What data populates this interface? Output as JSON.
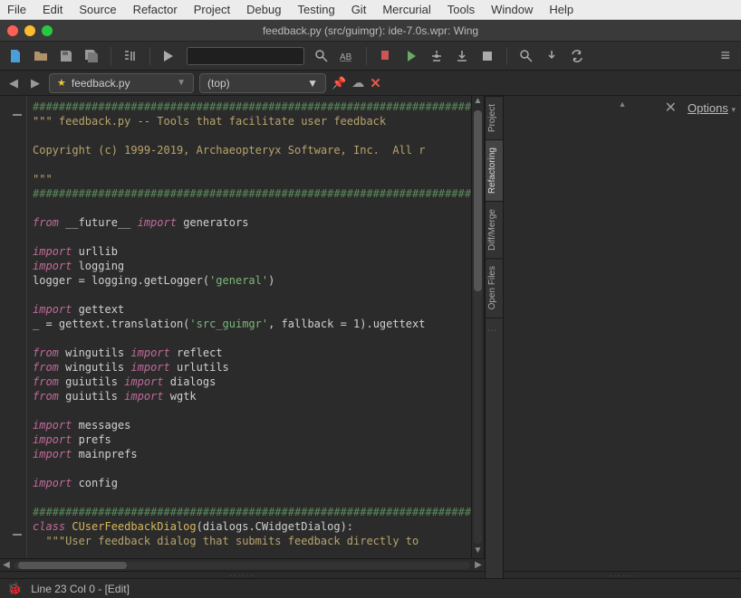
{
  "menubar": [
    "File",
    "Edit",
    "Source",
    "Refactor",
    "Project",
    "Debug",
    "Testing",
    "Git",
    "Mercurial",
    "Tools",
    "Window",
    "Help"
  ],
  "window_title": "feedback.py (src/guimgr): ide-7.0s.wpr: Wing",
  "tab": {
    "filename": "feedback.py"
  },
  "scope": {
    "label": "(top)"
  },
  "side": {
    "options_label": "Options",
    "tabs": [
      "Project",
      "Refactoring",
      "Diff/Merge",
      "Open Files"
    ]
  },
  "status": {
    "text": "Line 23 Col 0 - [Edit]"
  },
  "code": {
    "l1": "########################################################################",
    "l2": "\"\"\" feedback.py -- Tools that facilitate user feedback",
    "l3": "",
    "l4": "Copyright (c) 1999-2019, Archaeopteryx Software, Inc.  All r",
    "l5": "",
    "l6": "\"\"\"",
    "l7": "########################################################################",
    "l8": "",
    "l9a": "from",
    "l9b": " __future__ ",
    "l9c": "import",
    "l9d": " generators",
    "l10": "",
    "l11a": "import",
    "l11b": " urllib",
    "l12a": "import",
    "l12b": " logging",
    "l13a": "logger = logging.getLogger(",
    "l13b": "'general'",
    "l13c": ")",
    "l14": "",
    "l15a": "import",
    "l15b": " gettext",
    "l16a": "_ = gettext.translation(",
    "l16b": "'src_guimgr'",
    "l16c": ", fallback = 1).ugettext",
    "l17": "",
    "l18a": "from",
    "l18b": " wingutils ",
    "l18c": "import",
    "l18d": " reflect",
    "l19a": "from",
    "l19b": " wingutils ",
    "l19c": "import",
    "l19d": " urlutils",
    "l20a": "from",
    "l20b": " guiutils ",
    "l20c": "import",
    "l20d": " dialogs",
    "l21a": "from",
    "l21b": " guiutils ",
    "l21c": "import",
    "l21d": " wgtk",
    "l22": "",
    "l23a": "import",
    "l23b": " messages",
    "l24a": "import",
    "l24b": " prefs",
    "l25a": "import",
    "l25b": " mainprefs",
    "l26": "",
    "l27a": "import",
    "l27b": " config",
    "l28": "",
    "l29": "########################################################################",
    "l30a": "class ",
    "l30b": "CUserFeedbackDialog",
    "l30c": "(dialogs.CWidgetDialog):",
    "l31": "  \"\"\"User feedback dialog that submits feedback directly to "
  }
}
